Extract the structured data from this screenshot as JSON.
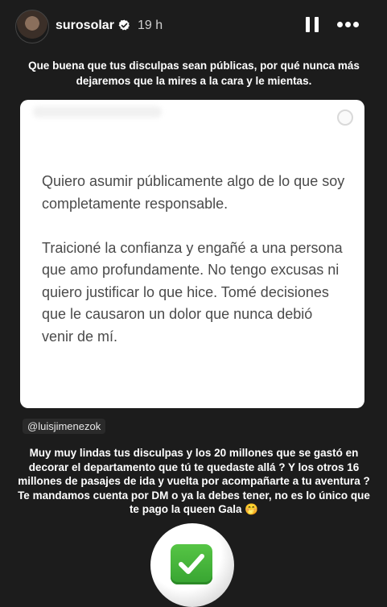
{
  "header": {
    "username": "surosolar",
    "time": "19 h",
    "icons": {
      "verified": "verified-badge-icon",
      "pause": "pause-icon",
      "more": "more-options-icon"
    }
  },
  "caption_top": "Que buena que tus disculpas sean públicas, por qué nunca más dejaremos que la mires a la cara y le mientas.",
  "card": {
    "paragraph1": "Quiero asumir públicamente algo de lo que soy completamente responsable.",
    "paragraph2": "Traicioné la confianza y engañé a una persona que amo profundamente. No tengo excusas ni quiero justificar lo que hice. Tomé decisiones que le causaron un dolor que nunca debió venir de mí."
  },
  "mention": "@luisjimenezok",
  "caption_bottom": "Muy muy lindas tus disculpas y los 20 millones que se gastó en decorar el departamento que tú te quedaste allá ? Y los otros 16 millones de pasajes de ida y vuelta por acompañarte a tu aventura ? Te mandamos cuenta por DM o ya la debes tener, no es lo único que te pago la queen Gala 🤭",
  "sticker": {
    "icon": "check-mark-button-icon"
  },
  "colors": {
    "background": "#1c1c1c",
    "card": "#ffffff",
    "card_text": "#4a4a4a",
    "check_green": "#43b53a"
  }
}
